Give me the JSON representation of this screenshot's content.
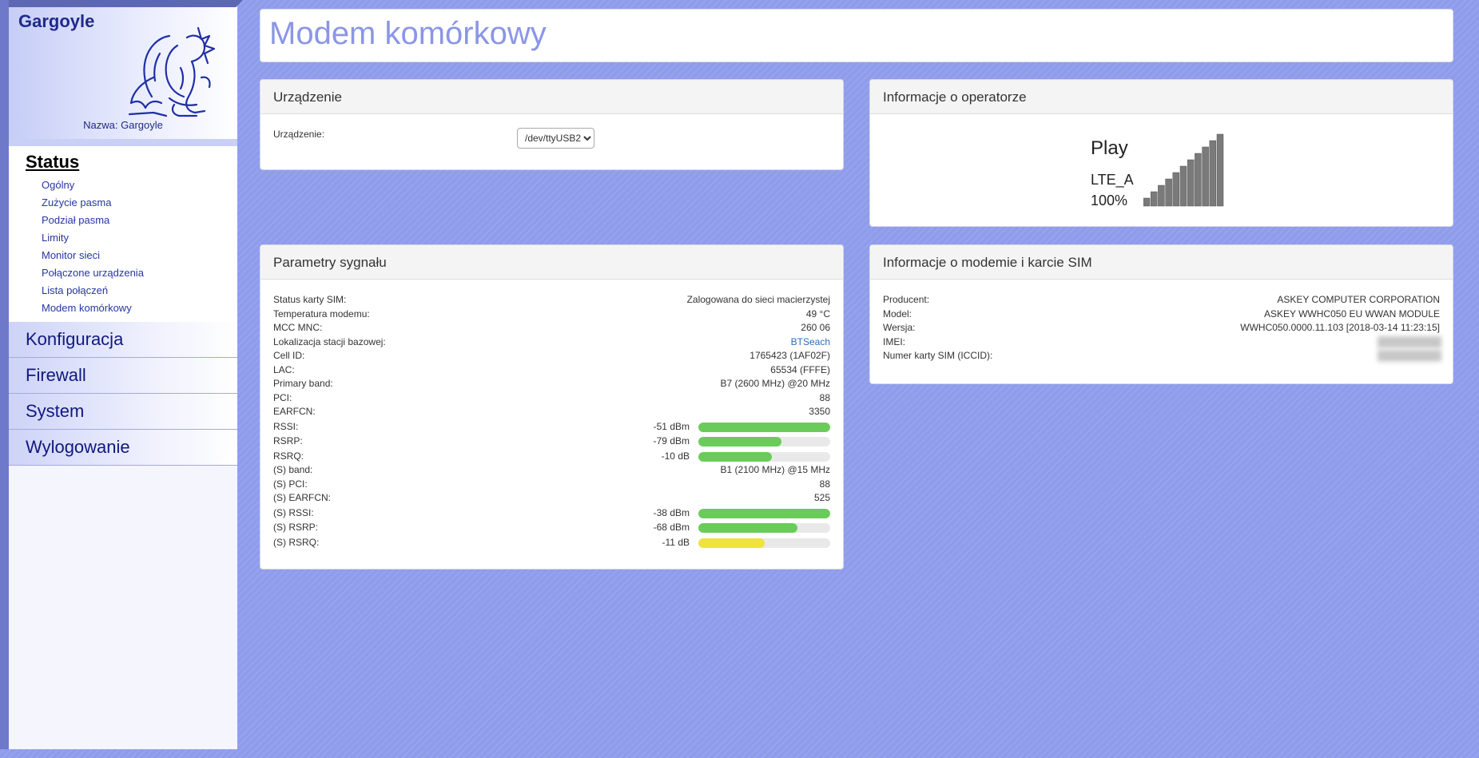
{
  "sidebar": {
    "brand_title": "Gargoyle",
    "device_caption": "Nazwa: Gargoyle",
    "status_heading": "Status",
    "status_items": [
      "Ogólny",
      "Zużycie pasma",
      "Podział pasma",
      "Limity",
      "Monitor sieci",
      "Połączone urządzenia",
      "Lista połączeń",
      "Modem komórkowy"
    ],
    "main_items": [
      "Konfiguracja",
      "Firewall",
      "System",
      "Wylogowanie"
    ]
  },
  "page": {
    "title": "Modem komórkowy"
  },
  "device_panel": {
    "title": "Urządzenie",
    "label": "Urządzenie:",
    "selected": "/dev/ttyUSB2"
  },
  "operator_panel": {
    "title": "Informacje o operatorze",
    "operator": "Play",
    "technology": "LTE_A",
    "signal_percent": "100%",
    "signal_level": 1.0,
    "bar_color": "#7a7a7a"
  },
  "signal_panel": {
    "title": "Parametry sygnału",
    "rows": [
      {
        "label": "Status karty SIM:",
        "value": "Zalogowana do sieci macierzystej"
      },
      {
        "label": "Temperatura modemu:",
        "value": "49 °C"
      },
      {
        "label": "MCC MNC:",
        "value": "260 06"
      },
      {
        "label": "Lokalizacja stacji bazowej:",
        "value": "BTSeach",
        "link": true
      },
      {
        "label": "Cell ID:",
        "value": "1765423 (1AF02F)"
      },
      {
        "label": "LAC:",
        "value": "65534 (FFFE)"
      },
      {
        "label": "Primary band:",
        "value": "B7 (2600 MHz) @20 MHz"
      },
      {
        "label": "PCI:",
        "value": "88"
      },
      {
        "label": "EARFCN:",
        "value": "3350"
      },
      {
        "label": "RSSI:",
        "value": "-51 dBm",
        "level": 1.0,
        "color": "#6bcb5a"
      },
      {
        "label": "RSRP:",
        "value": "-79 dBm",
        "level": 0.63,
        "color": "#6bcb5a"
      },
      {
        "label": "RSRQ:",
        "value": "-10 dB",
        "level": 0.56,
        "color": "#6bcb5a"
      },
      {
        "label": "(S) band:",
        "value": "B1 (2100 MHz) @15 MHz"
      },
      {
        "label": "(S) PCI:",
        "value": "88"
      },
      {
        "label": "(S) EARFCN:",
        "value": "525"
      },
      {
        "label": "(S) RSSI:",
        "value": "-38 dBm",
        "level": 1.0,
        "color": "#6bcb5a"
      },
      {
        "label": "(S) RSRP:",
        "value": "-68 dBm",
        "level": 0.75,
        "color": "#6bcb5a"
      },
      {
        "label": "(S) RSRQ:",
        "value": "-11 dB",
        "level": 0.5,
        "color": "#f0e33c"
      }
    ]
  },
  "modem_panel": {
    "title": "Informacje o modemie i karcie SIM",
    "rows": [
      {
        "label": "Producent:",
        "value": "ASKEY COMPUTER CORPORATION"
      },
      {
        "label": "Model:",
        "value": "ASKEY WWHC050 EU WWAN MODULE"
      },
      {
        "label": "Wersja:",
        "value": "WWHC050.0000.11.103 [2018-03-14 11:23:15]"
      },
      {
        "label": "IMEI:",
        "value": "",
        "hidden": true
      },
      {
        "label": "Numer karty SIM (ICCID):",
        "value": "",
        "hidden": true
      }
    ]
  },
  "colors": {
    "background": "#8f9ceb",
    "title_text": "#8b96e6",
    "menu_text": "#101880",
    "link": "#2a6ebb"
  }
}
